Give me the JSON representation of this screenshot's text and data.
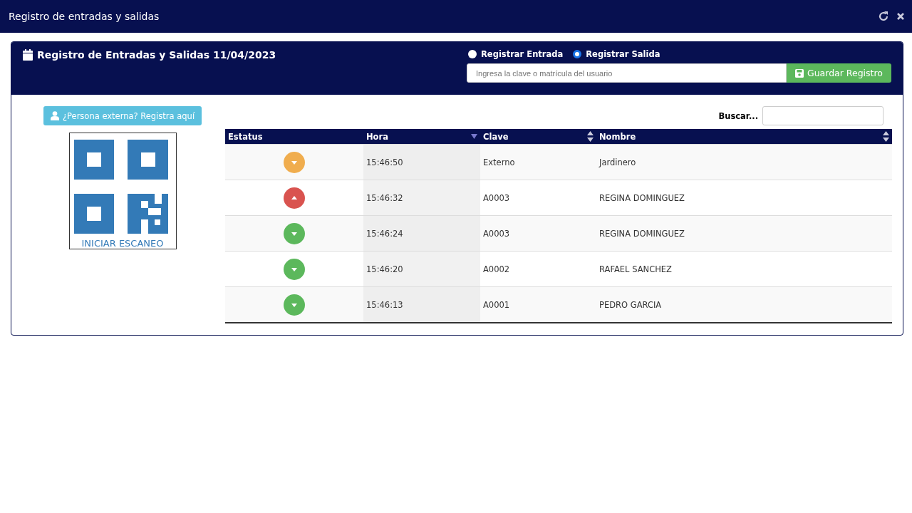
{
  "window": {
    "title": "Registro de entradas y salidas"
  },
  "panel": {
    "title": "Registro de Entradas y Salidas 11/04/2023",
    "radios": [
      {
        "label": "Registrar Entrada",
        "selected": false
      },
      {
        "label": "Registrar Salida",
        "selected": true
      }
    ],
    "input": {
      "placeholder": "Ingresa la clave o matrícula del usuario"
    },
    "save_button": "Guardar Registro"
  },
  "external_button": "¿Persona externa? Registra aquí",
  "scan_label": "INICIAR ESCANEO",
  "search": {
    "label": "Buscar..."
  },
  "table": {
    "columns": [
      {
        "label": "Estatus",
        "kind": "plain"
      },
      {
        "label": "Hora",
        "kind": "descending"
      },
      {
        "label": "Clave",
        "kind": "sortable"
      },
      {
        "label": "Nombre",
        "kind": "sortable"
      }
    ],
    "rows": [
      {
        "kind": "down",
        "color": "#f0ad4e",
        "hora": "15:46:50",
        "clave": "Externo",
        "nombre": "Jardinero"
      },
      {
        "kind": "up",
        "color": "#d9534f",
        "hora": "15:46:32",
        "clave": "A0003",
        "nombre": "REGINA DOMINGUEZ"
      },
      {
        "kind": "down",
        "color": "#5cb85c",
        "hora": "15:46:24",
        "clave": "A0003",
        "nombre": "REGINA DOMINGUEZ"
      },
      {
        "kind": "down",
        "color": "#5cb85c",
        "hora": "15:46:20",
        "clave": "A0002",
        "nombre": "RAFAEL SANCHEZ"
      },
      {
        "kind": "down",
        "color": "#5cb85c",
        "hora": "15:46:13",
        "clave": "A0001",
        "nombre": "PEDRO GARCIA"
      }
    ]
  }
}
